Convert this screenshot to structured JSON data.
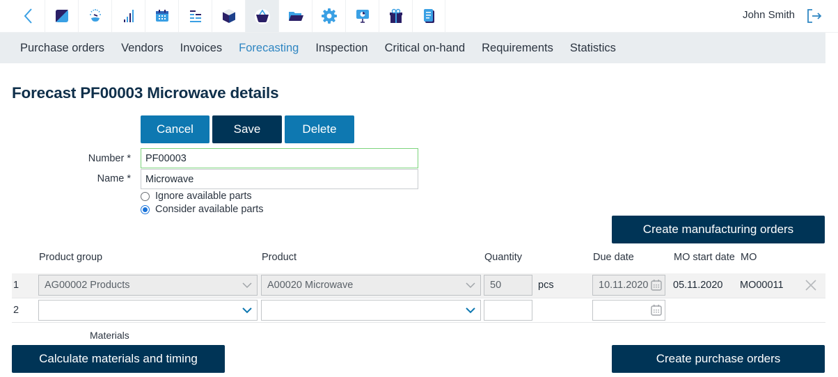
{
  "topbar": {
    "back_icon": "chevron-left-icon",
    "icon_tabs": [
      {
        "name": "dashboard-icon",
        "active": false
      },
      {
        "name": "gauge-icon",
        "active": false
      },
      {
        "name": "signal-bars-icon",
        "active": false
      },
      {
        "name": "calendar-icon",
        "active": false
      },
      {
        "name": "gantt-icon",
        "active": false
      },
      {
        "name": "box-icon",
        "active": false
      },
      {
        "name": "basket-icon",
        "active": true
      },
      {
        "name": "folder-icon",
        "active": false
      },
      {
        "name": "gear-icon",
        "active": false
      },
      {
        "name": "presentation-icon",
        "active": false
      },
      {
        "name": "gift-icon",
        "active": false
      },
      {
        "name": "document-icon",
        "active": false
      }
    ],
    "user_name": "John Smith",
    "logout_icon": "logout-icon"
  },
  "subnav": {
    "items": [
      {
        "label": "Purchase orders",
        "active": false
      },
      {
        "label": "Vendors",
        "active": false
      },
      {
        "label": "Invoices",
        "active": false
      },
      {
        "label": "Forecasting",
        "active": true
      },
      {
        "label": "Inspection",
        "active": false
      },
      {
        "label": "Critical on-hand",
        "active": false
      },
      {
        "label": "Requirements",
        "active": false
      },
      {
        "label": "Statistics",
        "active": false
      }
    ]
  },
  "page": {
    "title": "Forecast PF00003 Microwave details",
    "actions": {
      "cancel": "Cancel",
      "save": "Save",
      "delete": "Delete"
    },
    "form": {
      "number_label": "Number *",
      "number_value": "PF00003",
      "name_label": "Name *",
      "name_value": "Microwave",
      "radio_options": [
        {
          "label": "Ignore available parts",
          "checked": false
        },
        {
          "label": "Consider available parts",
          "checked": true
        }
      ]
    },
    "create_mo_button": "Create manufacturing orders",
    "table": {
      "headers": {
        "product_group": "Product group",
        "product": "Product",
        "quantity": "Quantity",
        "due_date": "Due date",
        "mo_start_date": "MO start date",
        "mo": "MO"
      },
      "rows": [
        {
          "num": "1",
          "product_group": "AG00002 Products",
          "product": "A00020 Microwave",
          "quantity": "50",
          "unit": "pcs",
          "due_date": "10.11.2020",
          "mo_start_date": "05.11.2020",
          "mo": "MO00011"
        },
        {
          "num": "2",
          "product_group": "",
          "product": "",
          "quantity": "",
          "unit": "",
          "due_date": "",
          "mo_start_date": "",
          "mo": ""
        }
      ]
    },
    "materials_label": "Materials",
    "calculate_button": "Calculate materials and timing",
    "create_po_button": "Create purchase orders"
  },
  "colors": {
    "accent_blue": "#0e78b1",
    "navy": "#003456",
    "active_link": "#2f86c2",
    "valid_border": "#7bd37b"
  }
}
